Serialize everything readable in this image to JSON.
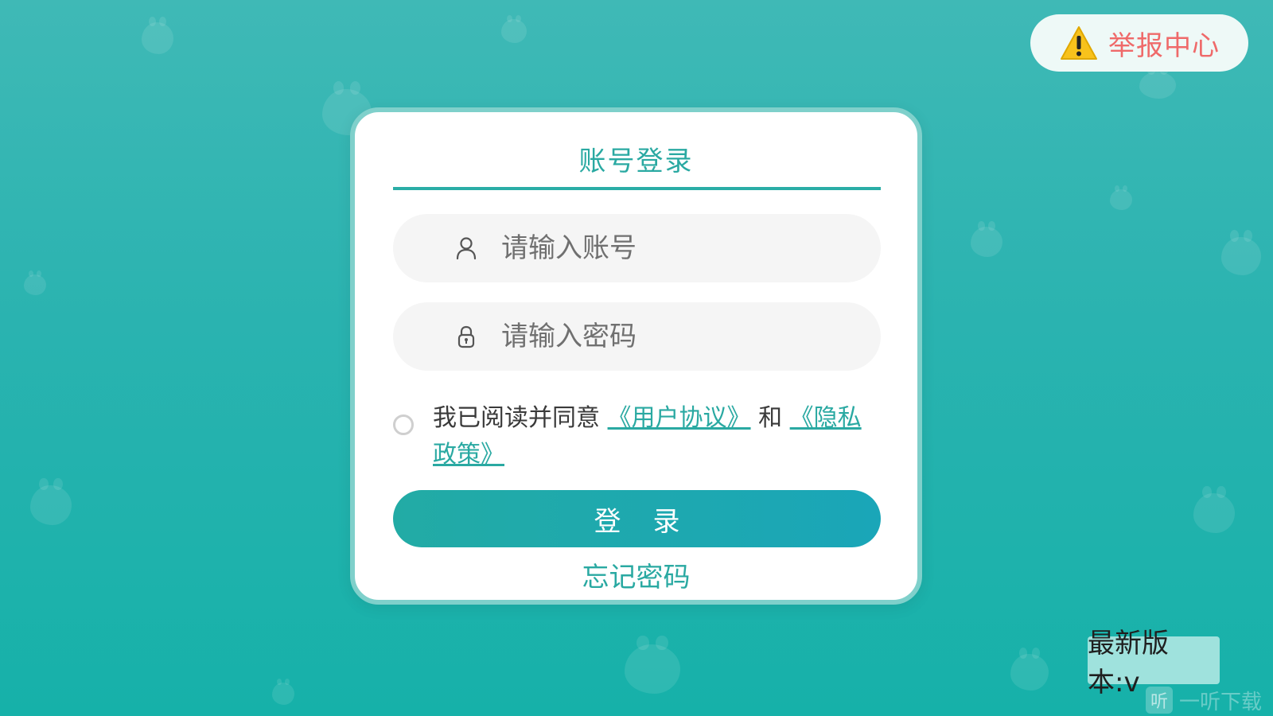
{
  "report": {
    "icon": "warning-triangle-icon",
    "label": "举报中心"
  },
  "login_card": {
    "title": "账号登录",
    "account_field": {
      "icon": "user-icon",
      "placeholder": "请输入账号",
      "value": ""
    },
    "password_field": {
      "icon": "lock-icon",
      "placeholder": "请输入密码",
      "value": ""
    },
    "agreement": {
      "checked": false,
      "prefix": "我已阅读并同意",
      "user_agreement_link": "《用户协议》",
      "conjunction": "和",
      "privacy_link": "《隐私政策》"
    },
    "login_button": "登录",
    "forgot_password": "忘记密码"
  },
  "version": {
    "label": "最新版本:v"
  },
  "watermark": {
    "icon_glyph": "听",
    "text": "一听下载"
  },
  "colors": {
    "accent": "#2aa9a2",
    "background": "#2ab3b0",
    "report_text": "#ef6a6a",
    "card_border": "#7fd0cb"
  }
}
